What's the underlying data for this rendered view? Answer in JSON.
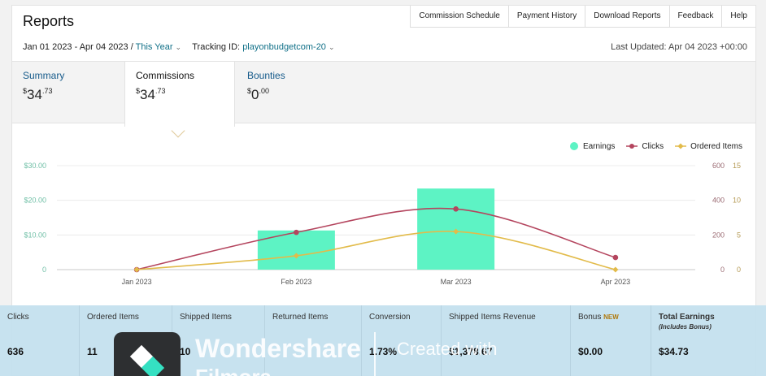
{
  "header": {
    "title": "Reports",
    "nav": [
      "Commission Schedule",
      "Payment History",
      "Download Reports",
      "Feedback",
      "Help"
    ],
    "date_range": "Jan 01 2023 - Apr 04 2023 /",
    "period": "This Year",
    "tracking_label": "Tracking ID:",
    "tracking_id": "playonbudgetcom-20",
    "last_updated": "Last Updated: Apr 04 2023 +00:00"
  },
  "tabs": [
    {
      "label": "Summary",
      "currency": "$",
      "whole": "34",
      "cents": ".73"
    },
    {
      "label": "Commissions",
      "currency": "$",
      "whole": "34",
      "cents": ".73"
    },
    {
      "label": "Bounties",
      "currency": "$",
      "whole": "0",
      "cents": ".00"
    }
  ],
  "chart_data": {
    "type": "bar",
    "categories": [
      "Jan 2023",
      "Feb 2023",
      "Mar 2023",
      "Apr 2023"
    ],
    "series": [
      {
        "name": "Earnings",
        "kind": "bar",
        "axis": "left",
        "color": "#5df3c4",
        "values": [
          0,
          11.3,
          23.4,
          0
        ]
      },
      {
        "name": "Clicks",
        "kind": "line",
        "axis": "right1",
        "color": "#b4455e",
        "values": [
          0,
          215,
          350,
          70
        ]
      },
      {
        "name": "Ordered Items",
        "kind": "line",
        "axis": "right2",
        "color": "#e2bb4a",
        "values": [
          0,
          2,
          5.5,
          0
        ]
      }
    ],
    "y_left_ticks": [
      "0",
      "$10.00",
      "$20.00",
      "$30.00"
    ],
    "y_left_range": [
      0,
      30
    ],
    "y_right1_ticks": [
      "0",
      "200",
      "400",
      "600"
    ],
    "y_right1_range": [
      0,
      600
    ],
    "y_right2_ticks": [
      "0",
      "5",
      "10",
      "15"
    ],
    "y_right2_range": [
      0,
      15
    ],
    "legend_position": "top-right",
    "grid": "horizontal"
  },
  "stats": [
    {
      "label": "Clicks",
      "value": "636"
    },
    {
      "label": "Ordered Items",
      "value": "11"
    },
    {
      "label": "Shipped Items",
      "value": "10"
    },
    {
      "label": "Returned Items",
      "value": ""
    },
    {
      "label": "Conversion",
      "value": "1.73%"
    },
    {
      "label": "Shipped Items Revenue",
      "value": "$1,378.67"
    },
    {
      "label": "Bonus",
      "badge": "NEW",
      "value": "$0.00"
    },
    {
      "label": "Total Earnings",
      "sub": "(Includes Bonus)",
      "value": "$34.73"
    }
  ],
  "watermark": {
    "brand": "Wondershare",
    "product": "Filmora",
    "created": "Created with"
  },
  "colors": {
    "link": "#0f6f87",
    "earnings": "#5df3c4",
    "clicks": "#b4455e",
    "ordered": "#e2bb4a",
    "stats_bg": "#c4e0ee"
  }
}
